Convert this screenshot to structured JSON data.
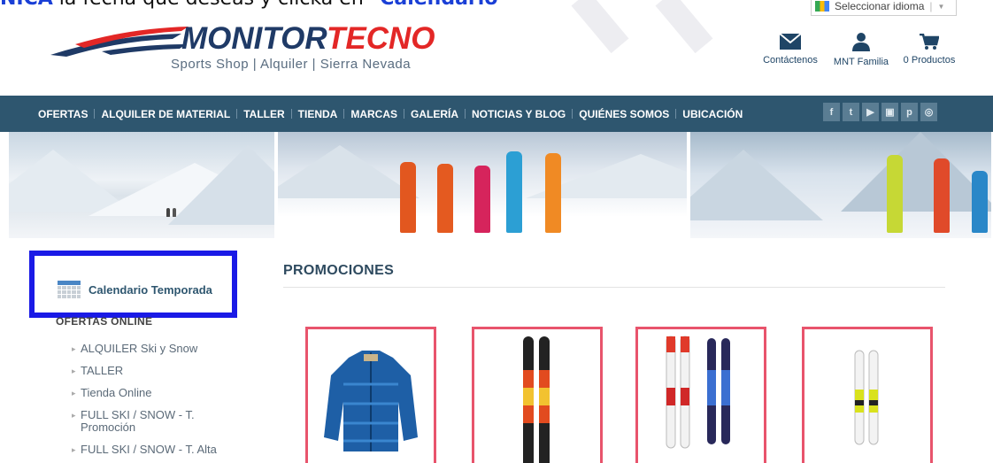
{
  "instruction": {
    "prefix": "NICA",
    "text": " la fecha que deseas y clicka en ",
    "link": "\"Calendario\""
  },
  "language_selector": {
    "label": "Seleccionar idioma",
    "arrow": "▼"
  },
  "logo": {
    "brand_primary": "MONITOR",
    "brand_secondary": "TECNO",
    "tagline": "Sports Shop | Alquiler | Sierra Nevada"
  },
  "header_icons": [
    {
      "icon": "envelope-icon",
      "label": "Contáctenos"
    },
    {
      "icon": "user-icon",
      "label": "MNT Familia"
    },
    {
      "icon": "cart-icon",
      "label": "0 Productos"
    }
  ],
  "nav": {
    "items": [
      "OFERTAS",
      "ALQUILER DE MATERIAL",
      "TALLER",
      "TIENDA",
      "MARCAS",
      "GALERÍA",
      "NOTICIAS Y BLOG",
      "QUIÉNES SOMOS",
      "UBICACIÓN"
    ],
    "social": [
      {
        "icon": "facebook-icon",
        "glyph": "f"
      },
      {
        "icon": "twitter-icon",
        "glyph": "t"
      },
      {
        "icon": "youtube-icon",
        "glyph": "▶"
      },
      {
        "icon": "instagram-icon",
        "glyph": "▣"
      },
      {
        "icon": "pinterest-icon",
        "glyph": "p"
      },
      {
        "icon": "tripadvisor-icon",
        "glyph": "◎"
      }
    ]
  },
  "sidebar": {
    "calendar_link": "Calendario Temporada",
    "heading": "OFERTAS ONLINE",
    "items": [
      "ALQUILER Ski y Snow",
      "TALLER",
      "Tienda Online",
      "FULL SKI / SNOW - T. Promoción",
      "FULL SKI / SNOW - T. Alta"
    ]
  },
  "main": {
    "title": "PROMOCIONES",
    "products": [
      {
        "name": "blue-down-jacket"
      },
      {
        "name": "red-skis"
      },
      {
        "name": "two-pairs-skis"
      },
      {
        "name": "yellow-skis"
      }
    ]
  },
  "colors": {
    "nav_bg": "#2e566f",
    "accent_red": "#e32726",
    "brand_blue": "#1f3a66",
    "highlight_box": "#1a1ae6",
    "product_border": "#e8546c"
  }
}
